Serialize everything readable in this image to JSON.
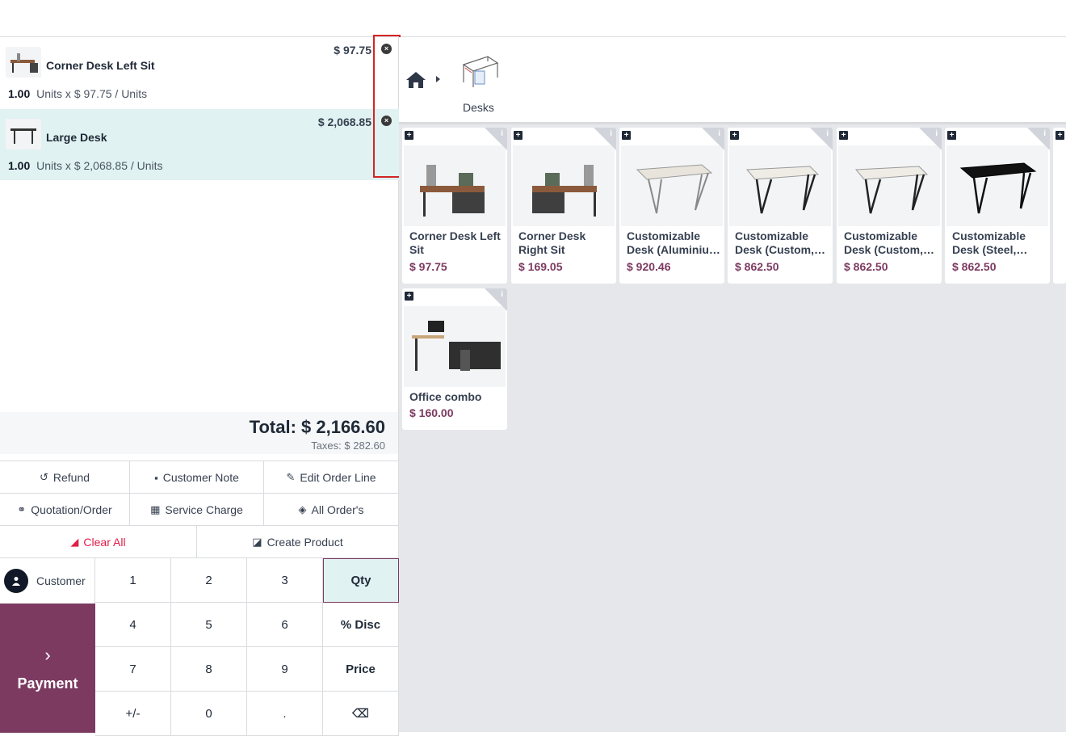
{
  "order": {
    "lines": [
      {
        "name": "Corner Desk Left Sit",
        "price": "$ 97.75",
        "qty": "1.00",
        "detail": "Units x $ 97.75 / Units",
        "selected": false
      },
      {
        "name": "Large Desk",
        "price": "$ 2,068.85",
        "qty": "1.00",
        "detail": "Units x $ 2,068.85 / Units",
        "selected": true
      }
    ],
    "total": "Total: $ 2,166.60",
    "taxes": "Taxes: $ 282.60"
  },
  "controls": {
    "refund": "Refund",
    "customer_note": "Customer Note",
    "edit_order_line": "Edit Order Line",
    "quotation_order": "Quotation/Order",
    "service_charge": "Service Charge",
    "all_orders": "All Order's",
    "clear_all": "Clear All",
    "create_product": "Create Product"
  },
  "keypad": {
    "customer": "Customer",
    "payment": "Payment",
    "keys": [
      "1",
      "2",
      "3",
      "Qty",
      "4",
      "5",
      "6",
      "% Disc",
      "7",
      "8",
      "9",
      "Price",
      "+/-",
      "0",
      ".",
      "⌫"
    ]
  },
  "breadcrumb": {
    "category": "Desks"
  },
  "products": [
    {
      "name": "Corner Desk Left Sit",
      "price": "$ 97.75"
    },
    {
      "name": "Corner Desk Right Sit",
      "price": "$ 169.05"
    },
    {
      "name": "Customizable Desk (Aluminiu…",
      "price": "$ 920.46"
    },
    {
      "name": "Customizable Desk (Custom,…",
      "price": "$ 862.50"
    },
    {
      "name": "Customizable Desk (Custom,…",
      "price": "$ 862.50"
    },
    {
      "name": "Customizable Desk (Steel,…",
      "price": "$ 862.50"
    },
    {
      "name": "Office combo",
      "price": "$ 160.00"
    }
  ],
  "colors": {
    "accent": "#7c3a61",
    "selected_bg": "#e0f2f1",
    "danger": "#e11d48",
    "highlight": "#d42525"
  }
}
